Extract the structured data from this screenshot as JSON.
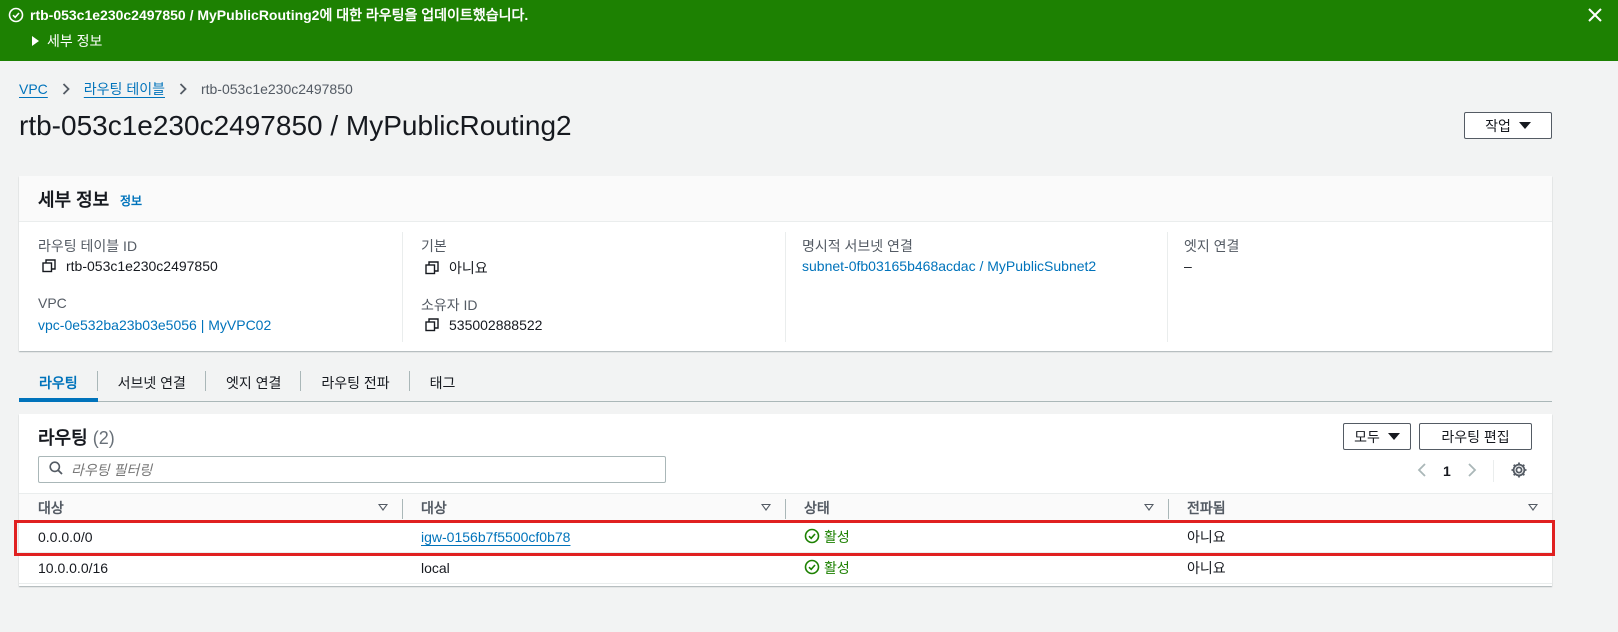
{
  "flash": {
    "message": "rtb-053c1e230c2497850 / MyPublicRouting2에 대한 라우팅을 업데이트했습니다.",
    "details_label": "세부 정보",
    "color": "#1d8102"
  },
  "breadcrumb": {
    "items": [
      "VPC",
      "라우팅 테이블"
    ],
    "current": "rtb-053c1e230c2497850"
  },
  "page": {
    "title": "rtb-053c1e230c2497850 / MyPublicRouting2",
    "actions_label": "작업"
  },
  "details": {
    "title": "세부 정보",
    "info_label": "정보",
    "route_table_id_label": "라우팅 테이블 ID",
    "route_table_id": "rtb-053c1e230c2497850",
    "vpc_label": "VPC",
    "vpc_value": "vpc-0e532ba23b03e5056 | MyVPC02",
    "main_label": "기본",
    "main_value": "아니요",
    "owner_label": "소유자 ID",
    "owner_value": "535002888522",
    "subnet_assoc_label": "명시적 서브넷 연결",
    "subnet_assoc_value": "subnet-0fb03165b468acdac / MyPublicSubnet2",
    "edge_assoc_label": "엣지 연결",
    "edge_assoc_value": "–"
  },
  "tabs": [
    "라우팅",
    "서브넷 연결",
    "엣지 연결",
    "라우팅 전파",
    "태그"
  ],
  "routes": {
    "title": "라우팅",
    "count": "(2)",
    "filter_label": "모두",
    "edit_label": "라우팅 편집",
    "search_placeholder": "라우팅 필터링",
    "page_number": "1",
    "columns": [
      "대상",
      "대상",
      "상태",
      "전파됨"
    ],
    "rows": [
      {
        "destination": "0.0.0.0/0",
        "target": "igw-0156b7f5500cf0b78",
        "status": "활성",
        "propagated": "아니요"
      },
      {
        "destination": "10.0.0.0/16",
        "target": "local",
        "status": "활성",
        "propagated": "아니요"
      }
    ]
  }
}
